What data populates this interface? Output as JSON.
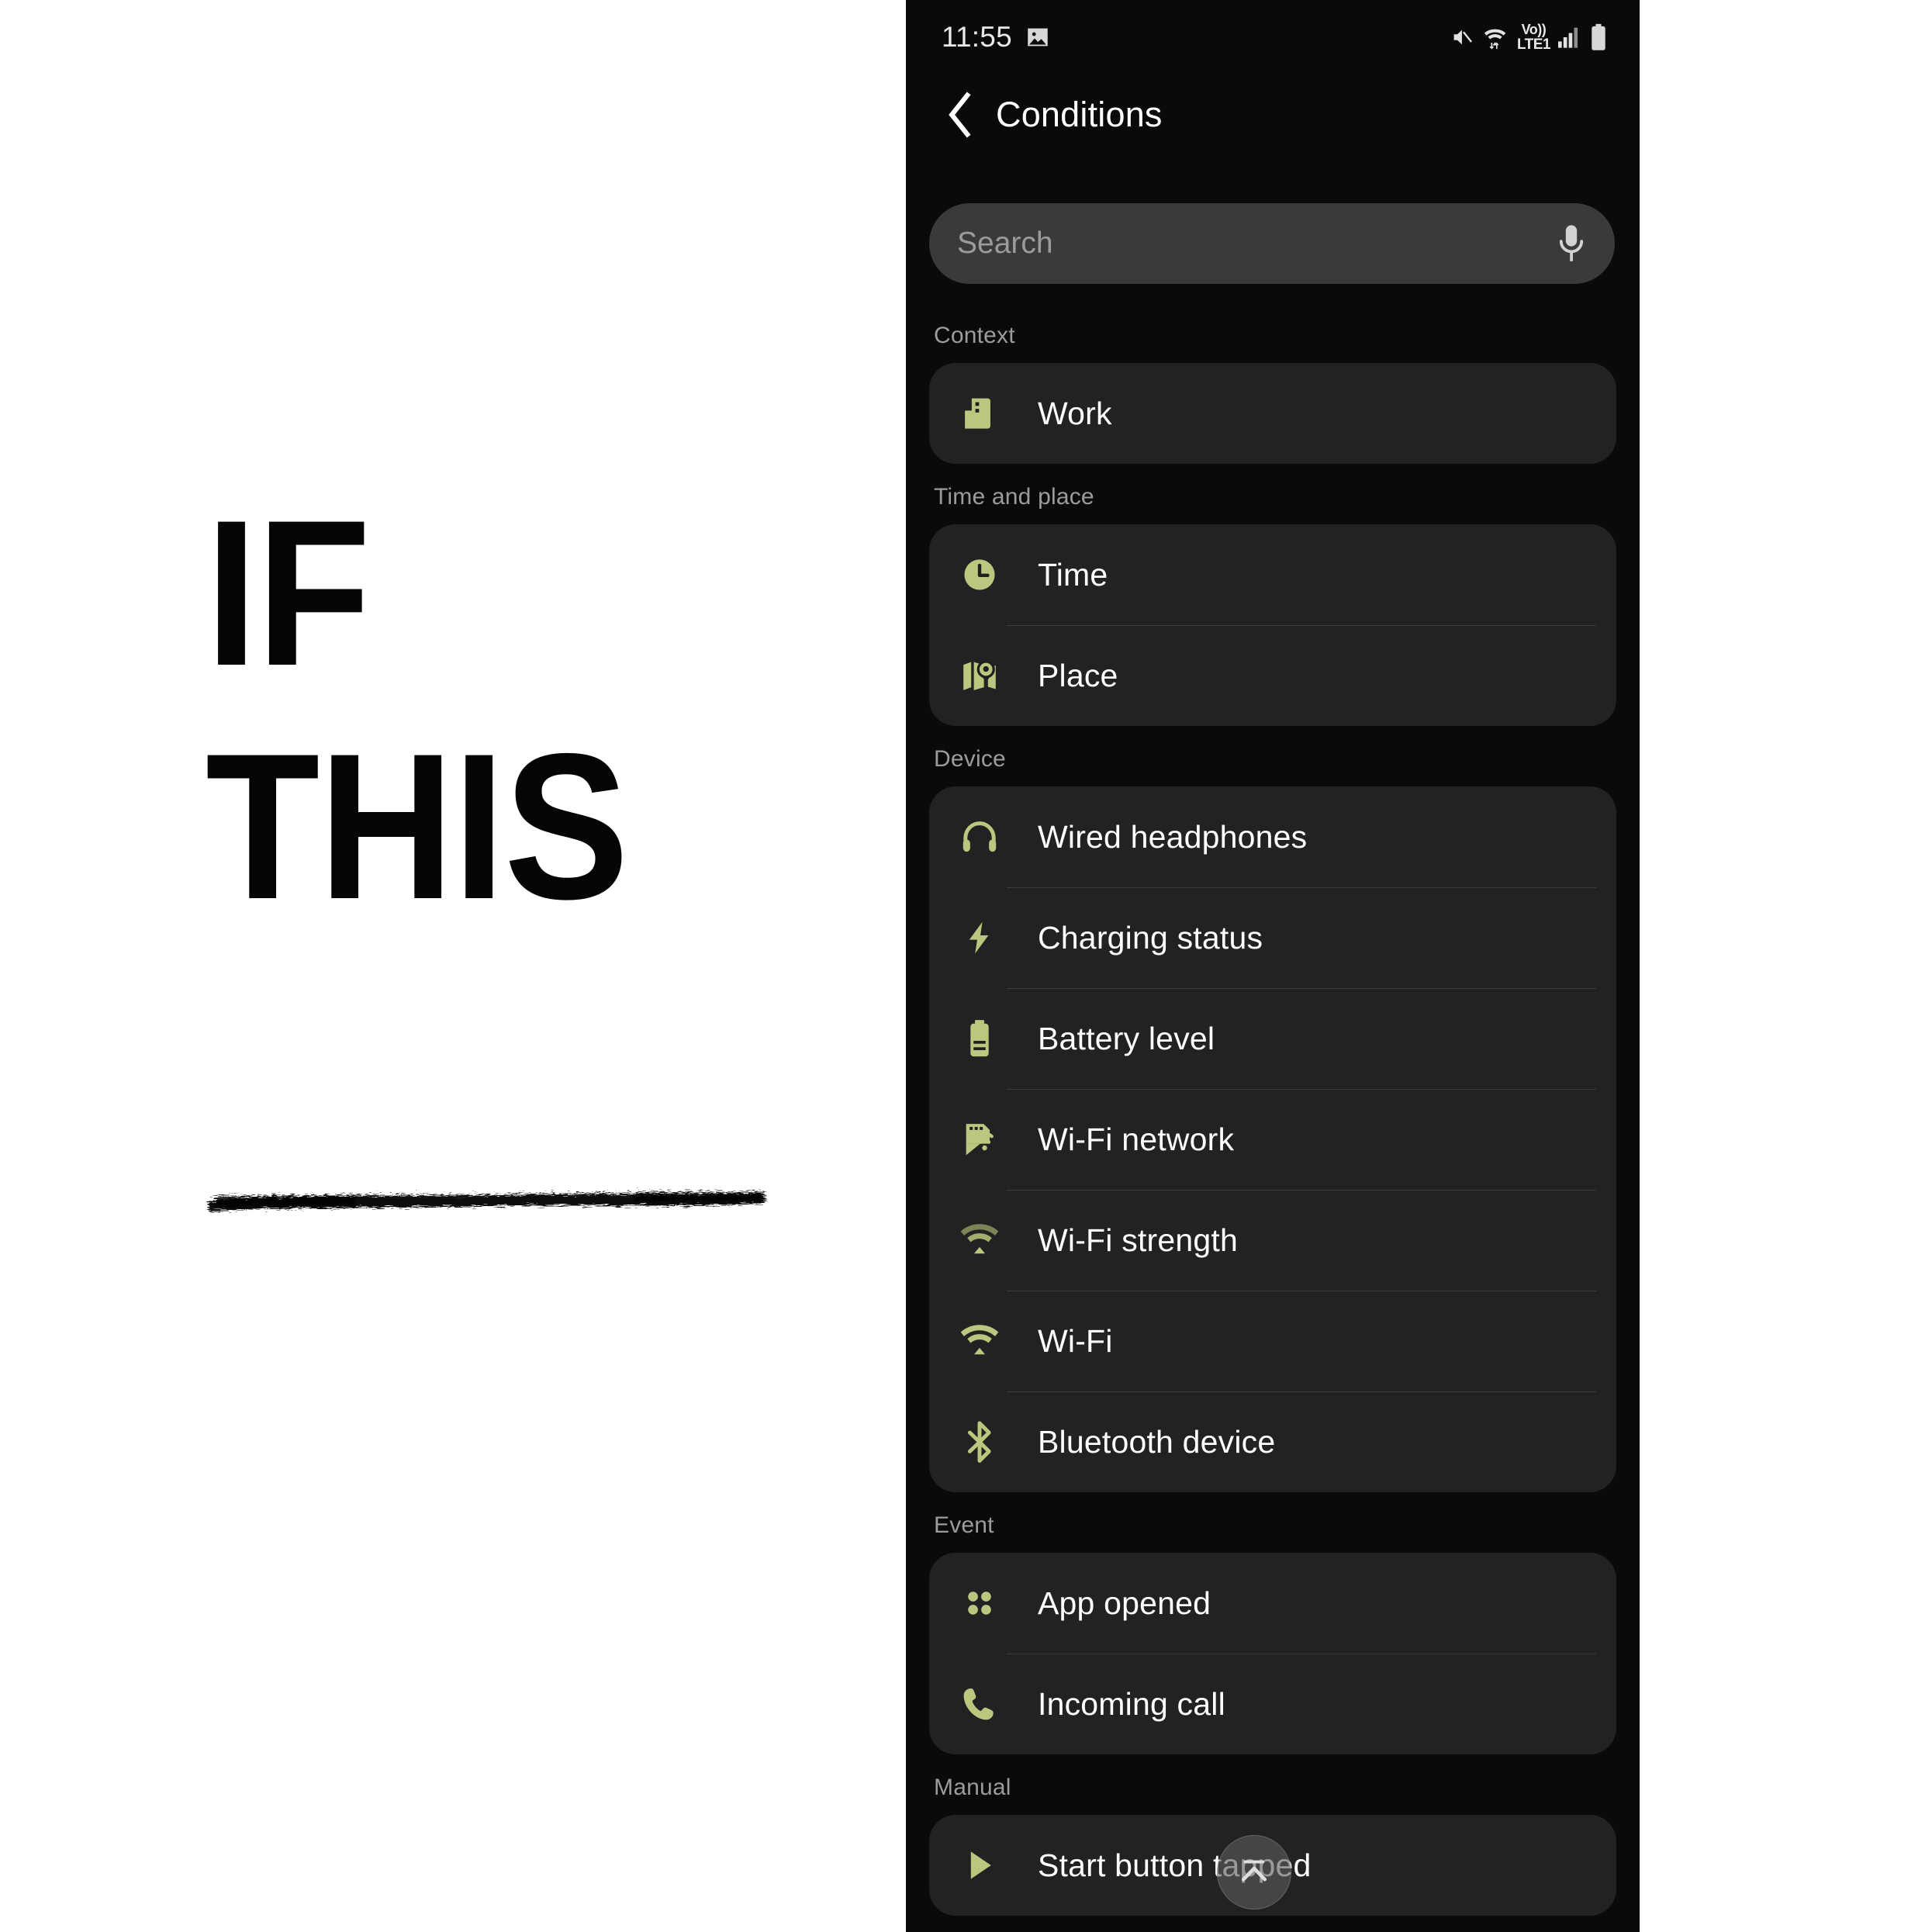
{
  "left_panel": {
    "wordmark_line1": "IF",
    "wordmark_line2": "THIS",
    "underline": "brush-underline-stroke"
  },
  "colors": {
    "page_background": "#ffffff",
    "wordmark": "#050505",
    "phone_background": "#0a0a0a",
    "card_background": "#222222",
    "search_background": "#3a3a3a",
    "icon_accent": "#bcc67f",
    "primary_text": "#ffffff",
    "secondary_text": "#9c9c9c",
    "divider": "#3d3d3d"
  },
  "status_bar": {
    "time": "11:55",
    "notification_icon": "image-icon",
    "icons": [
      "mute-icon",
      "wifi-data-icon",
      "volte-icon",
      "cellular-signal-icon",
      "battery-icon"
    ],
    "volte_top": "Vo))",
    "volte_bottom": "LTE1"
  },
  "app_bar": {
    "back_icon": "chevron-left-icon",
    "title": "Conditions"
  },
  "search": {
    "value": "",
    "placeholder": "Search",
    "mic_icon": "microphone-icon"
  },
  "sections": [
    {
      "header": "Context",
      "items": [
        {
          "label": "Work",
          "icon": "building-icon"
        }
      ]
    },
    {
      "header": "Time and place",
      "items": [
        {
          "label": "Time",
          "icon": "clock-icon"
        },
        {
          "label": "Place",
          "icon": "map-pin-icon"
        }
      ]
    },
    {
      "header": "Device",
      "items": [
        {
          "label": "Wired headphones",
          "icon": "headphones-icon"
        },
        {
          "label": "Charging status",
          "icon": "lightning-bolt-icon"
        },
        {
          "label": "Battery level",
          "icon": "battery-icon"
        },
        {
          "label": "Wi-Fi network",
          "icon": "router-wifi-icon"
        },
        {
          "label": "Wi-Fi strength",
          "icon": "wifi-signal-icon"
        },
        {
          "label": "Wi-Fi",
          "icon": "wifi-icon"
        },
        {
          "label": "Bluetooth device",
          "icon": "bluetooth-icon"
        }
      ]
    },
    {
      "header": "Event",
      "items": [
        {
          "label": "App opened",
          "icon": "apps-grid-icon"
        },
        {
          "label": "Incoming call",
          "icon": "phone-call-icon"
        }
      ]
    },
    {
      "header": "Manual",
      "items": [
        {
          "label": "Start button tapped",
          "icon": "play-triangle-icon"
        }
      ]
    }
  ],
  "scroll_top_fab": {
    "icon": "scroll-to-top-icon"
  }
}
